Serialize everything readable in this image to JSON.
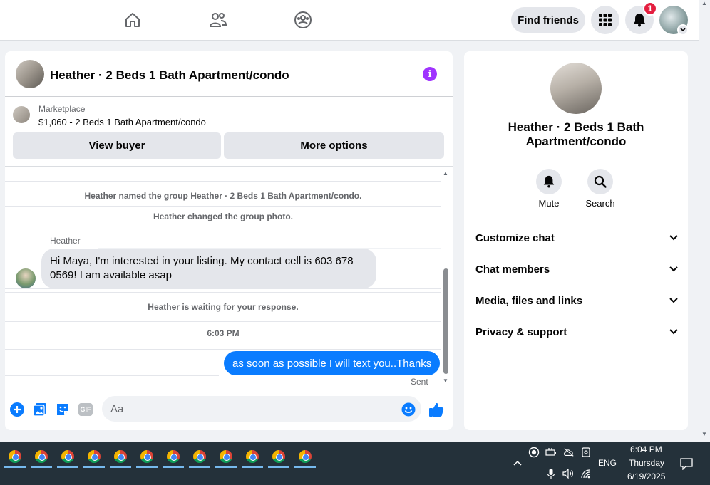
{
  "topbar": {
    "find_friends_label": "Find friends",
    "notification_count": "1",
    "icons": [
      "home-icon",
      "friends-icon",
      "groups-icon",
      "menu-grid-icon",
      "bell-icon",
      "chevron-down-icon"
    ]
  },
  "chat": {
    "title": "Heather · 2 Beds 1 Bath Apartment/condo",
    "marketplace_label": "Marketplace",
    "listing": "$1,060 - 2 Beds 1 Bath Apartment/condo",
    "view_buyer_label": "View buyer",
    "more_options_label": "More options",
    "system_messages": [
      "Heather named the group Heather · 2 Beds 1 Bath Apartment/condo.",
      "Heather changed the group photo.",
      "Heather is waiting for your response."
    ],
    "sender_name": "Heather",
    "incoming_message": "Hi Maya, I'm interested in your listing. My contact cell is 603 678 0569! I am available asap",
    "timestamp": "6:03 PM",
    "outgoing_message": "as soon as possible I will text you..Thanks",
    "sent_status": "Sent",
    "composer_placeholder": "Aa",
    "gif_label": "GIF"
  },
  "right_panel": {
    "name": "Heather · 2 Beds 1 Bath Apartment/condo",
    "mute_label": "Mute",
    "search_label": "Search",
    "sections": [
      "Customize chat",
      "Chat members",
      "Media, files and links",
      "Privacy & support"
    ]
  },
  "taskbar": {
    "app_count": 12,
    "language": "ENG",
    "time": "6:04 PM",
    "day": "Thursday",
    "date": "6/19/2025"
  },
  "colors": {
    "accent_blue": "#0a7cff",
    "info_purple": "#a033ff",
    "badge_red": "#e41e3f",
    "taskbar_bg": "#24313a"
  }
}
